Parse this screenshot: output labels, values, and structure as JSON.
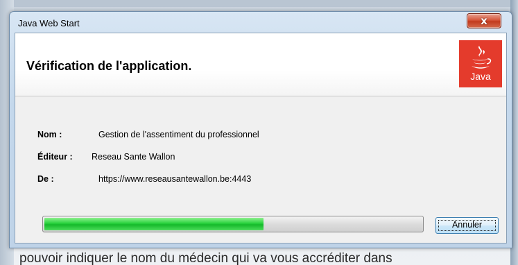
{
  "background": {
    "partial_text": "pouvoir indiquer le nom du médecin qui va vous accréditer dans"
  },
  "window": {
    "title": "Java Web Start",
    "close_label": "x"
  },
  "header": {
    "title": "Vérification de l'application.",
    "logo_text": "Java",
    "logo_color": "#e43b2c"
  },
  "details": {
    "name_label": "Nom :",
    "name_value": "Gestion de l'assentiment du professionnel",
    "publisher_label": "Éditeur :",
    "publisher_value": "Reseau Sante Wallon",
    "from_label": "De :",
    "from_value": "https://www.reseausantewallon.be:4443"
  },
  "progress": {
    "percent": 58,
    "fill_color": "#27d23c"
  },
  "buttons": {
    "cancel_label": "Annuler"
  }
}
